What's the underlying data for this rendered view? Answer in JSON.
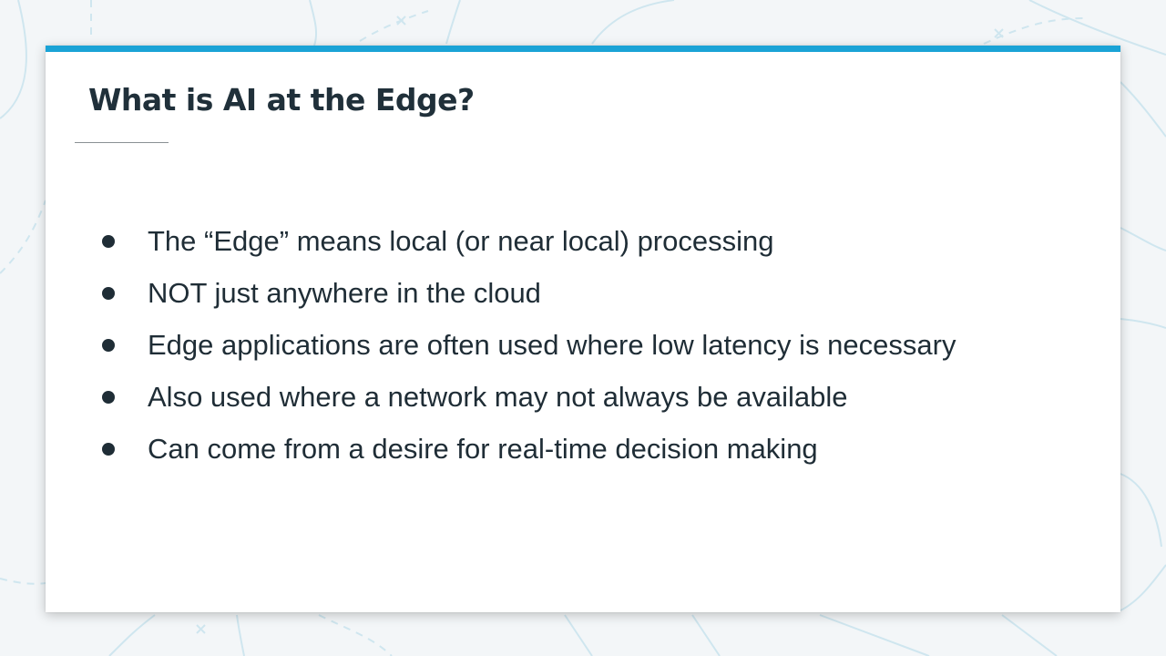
{
  "slide": {
    "title": "What is AI at the Edge?",
    "bullets": [
      "The “Edge” means local (or near local) processing",
      "NOT just anywhere in the cloud",
      "Edge applications are often used where low latency is necessary",
      "Also used where a network may not always be available",
      "Can come from a desire for real-time decision making"
    ]
  },
  "colors": {
    "accent": "#1aa3d6",
    "text": "#1f2d36",
    "background": "#f3f6f8"
  }
}
